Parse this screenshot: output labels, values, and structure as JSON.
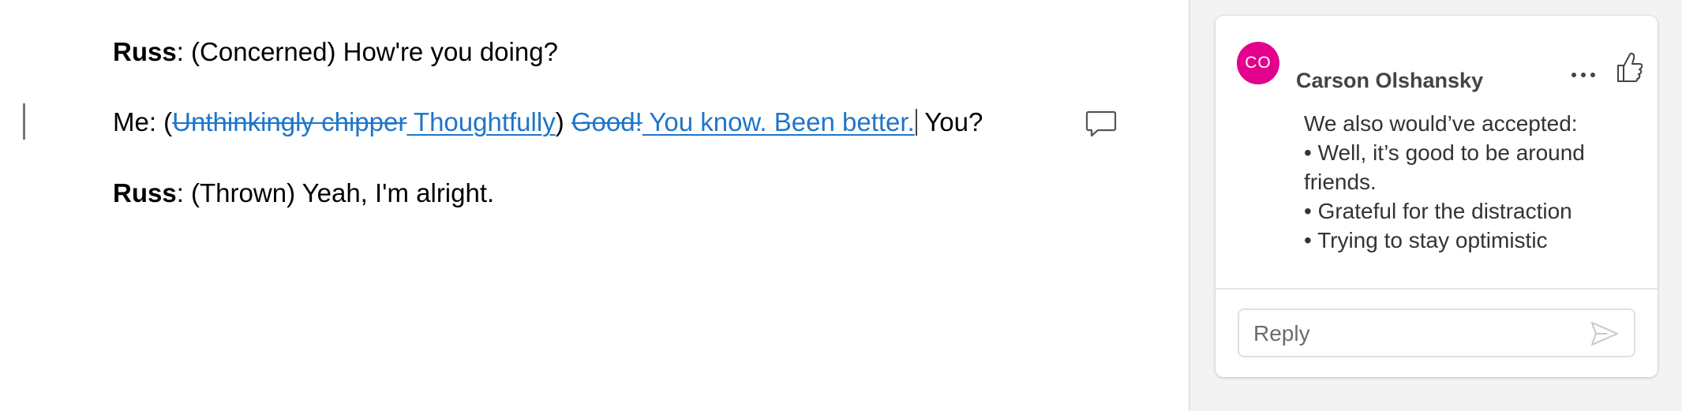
{
  "document": {
    "lines": [
      {
        "speaker": "Russ",
        "text": ": (Concerned) How're you doing?"
      },
      {
        "prefix": "Me: (",
        "deleted_1": "Unthinkingly chipper",
        "inserted_1": " Thoughtfully",
        "middle": ") ",
        "deleted_2": "Good!",
        "inserted_2": " You know. Been better.",
        "suffix": " You?"
      },
      {
        "speaker": "Russ",
        "text": ": (Thrown) Yeah, I'm alright."
      }
    ]
  },
  "comment": {
    "avatar_initials": "CO",
    "avatar_color": "#e3008c",
    "author": "Carson Olshansky",
    "body": [
      "We also would’ve accepted:",
      "• Well, it’s good to be around",
      "friends.",
      "• Grateful for the distraction",
      "• Trying to stay optimistic"
    ],
    "reply_placeholder": "Reply",
    "icons": [
      "more-options-icon",
      "thumbs-up-icon",
      "send-icon",
      "comment-icon"
    ]
  },
  "colors": {
    "track_change": "#1f75c9",
    "avatar": "#e3008c"
  }
}
